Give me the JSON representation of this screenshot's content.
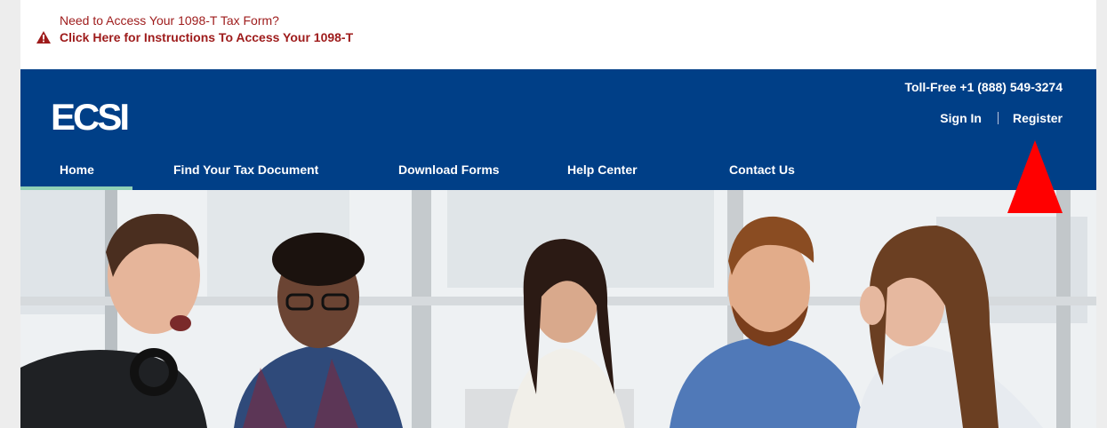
{
  "alert": {
    "question": "Need to Access Your 1098-T Tax Form?",
    "link_label": "Click Here for Instructions To Access Your 1098-T",
    "icon": "warning-triangle-icon",
    "color": "#9e1b1b"
  },
  "header": {
    "logo_text": "ECSI",
    "toll_free": "Toll-Free +1 (888) 549-3274",
    "sign_in": "Sign In",
    "register": "Register",
    "background_color": "#003f87",
    "active_underline_color": "#8fd0b6"
  },
  "nav": {
    "items": [
      {
        "label": "Home",
        "active": true
      },
      {
        "label": "Find Your Tax Document",
        "active": false
      },
      {
        "label": "Download Forms",
        "active": false
      },
      {
        "label": "Help Center",
        "active": false
      },
      {
        "label": "Contact Us",
        "active": false
      }
    ]
  },
  "hero": {
    "image": "group-of-laughing-students-photo"
  },
  "annotation": {
    "icon": "red-arrow-up-icon",
    "color": "#ff0000"
  }
}
